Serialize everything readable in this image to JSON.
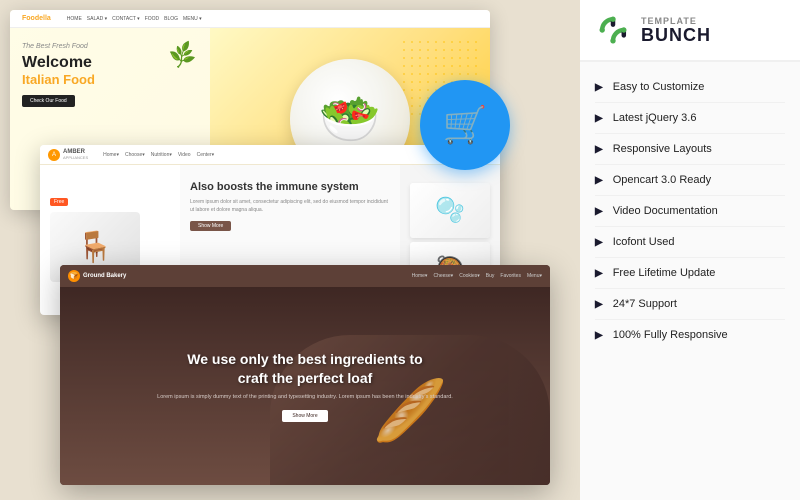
{
  "left": {
    "top_mockup": {
      "logo": "Foodella",
      "nav_items": [
        "HOME",
        "SALAD",
        "CONTACT",
        "FOOD",
        "BLOG",
        "MENU"
      ],
      "welcome_small": "The Best Fresh Food",
      "welcome_title": "Welcome",
      "welcome_subtitle": "Italian Food",
      "cta_label": "Check Our Food",
      "food_emoji": "🥗",
      "leaf_emoji": "🌿"
    },
    "middle_mockup": {
      "logo": "AMBER",
      "tagline": "APPLIANCES",
      "nav_items": [
        "Home",
        "Choose",
        "Nutrition",
        "Video",
        "Center"
      ],
      "product_emoji": "🪑",
      "side_product_emoji": "🫧",
      "free_badge": "Free",
      "immune_title": "Also boosts the immune system",
      "immune_text": "Lorem ipsum dolor sit amet, consectetur adipiscing elit, sed do eiusmod tempor incididunt ut labore et dolore magna aliqua.",
      "more_btn": "Show More"
    },
    "bottom_mockup": {
      "bakery_name": "Ground Bakery",
      "bakery_icon": "🍞",
      "nav_items": [
        "Home",
        "Cheese",
        "Cookies",
        "Buy",
        "Favorites",
        "Menu"
      ],
      "bread_emoji": "🥖",
      "title_line1": "We use only the best ingredients to",
      "title_line2": "craft the perfect loaf",
      "subtitle": "Lorem ipsum is simply dummy text of the printing and typesetting industry. Lorem ipsum has been the industry's standard.",
      "cta_btn": "Show More"
    },
    "cart_icon": "🛒"
  },
  "right": {
    "header": {
      "template_label": "templaTe",
      "bunch_label": "BUNCH"
    },
    "features": [
      {
        "label": "Easy to Customize"
      },
      {
        "label": "Latest jQuery 3.6"
      },
      {
        "label": "Responsive Layouts"
      },
      {
        "label": "Opencart 3.0 Ready"
      },
      {
        "label": "Video Documentation"
      },
      {
        "label": "Icofont Used"
      },
      {
        "label": "Free Lifetime Update"
      },
      {
        "label": "24*7 Support"
      },
      {
        "label": "100% Fully Responsive"
      }
    ]
  }
}
